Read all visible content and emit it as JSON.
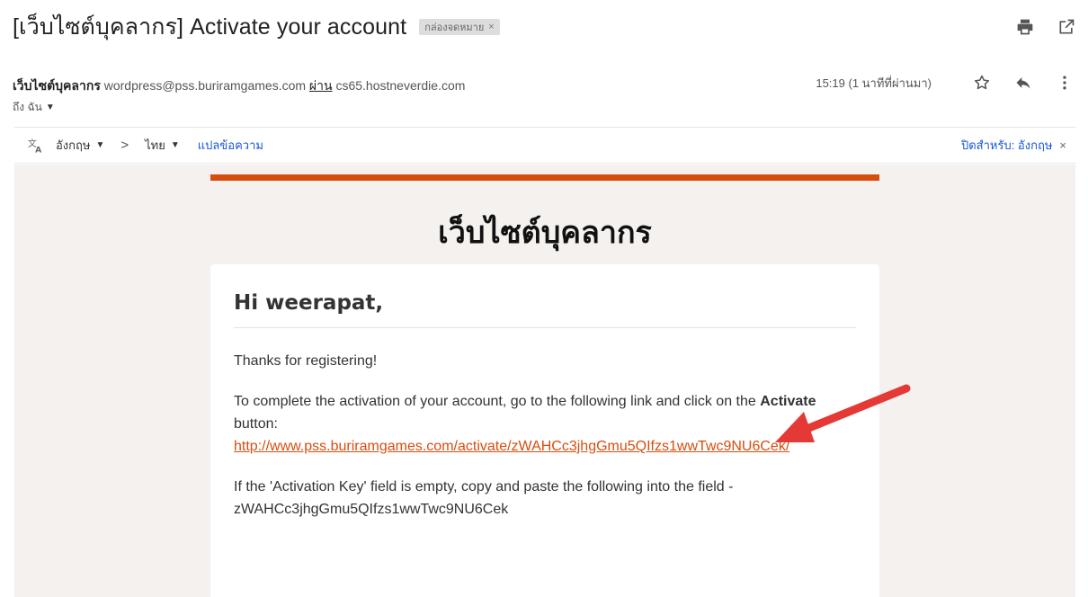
{
  "header": {
    "subject": "[เว็บไซต์บุคลากร] Activate your account",
    "label": "กล่องจดหมาย",
    "label_close": "×"
  },
  "sender": {
    "name": "เว็บไซต์บุคลากร",
    "email": "wordpress@pss.buriramgames.com",
    "via_label": "ผ่าน",
    "via_domain": "cs65.hostneverdie.com",
    "to": "ถึง ฉัน",
    "timestamp": "15:19 (1 นาทีที่ผ่านมา)"
  },
  "translate": {
    "from_lang": "อังกฤษ",
    "to_lang": "ไทย",
    "translate_link": "แปลข้อความ",
    "turn_off": "ปิดสำหรับ: อังกฤษ",
    "close": "×"
  },
  "email": {
    "site_title": "เว็บไซต์บุคลากร",
    "greeting": "Hi weerapat,",
    "thanks": "Thanks for registering!",
    "instruction_pre": "To complete the activation of your account, go to the following link and click on the",
    "activate_word": "Activate",
    "instruction_post": "button:",
    "activation_link": "http://www.pss.buriramgames.com/activate/zWAHCc3jhgGmu5QIfzs1wwTwc9NU6Cek/",
    "key_instruction": "If the 'Activation Key' field is empty, copy and paste the following into the field -",
    "activation_key": "zWAHCc3jhgGmu5QIfzs1wwTwc9NU6Cek"
  },
  "colors": {
    "accent": "#d54e0f",
    "link_blue": "#1a57d6",
    "email_bg": "#f5f1ee",
    "annotation_arrow": "#e53935"
  },
  "icons": {
    "print": "print-icon",
    "open_new_window": "open-new-window-icon",
    "star": "star-icon",
    "reply": "reply-icon",
    "more": "more-vert-icon",
    "translate": "translate-icon"
  }
}
